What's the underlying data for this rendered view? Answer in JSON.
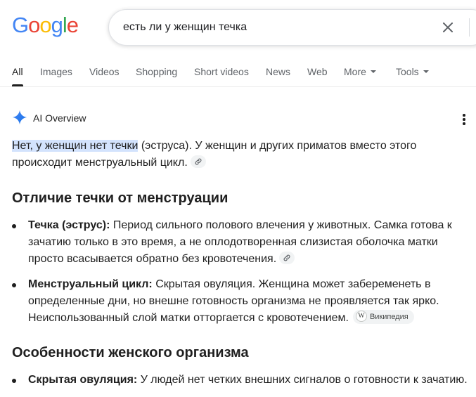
{
  "logo": {
    "letters": [
      "G",
      "o",
      "o",
      "g",
      "l",
      "e"
    ],
    "colors": [
      "#4285F4",
      "#EA4335",
      "#FBBC05",
      "#4285F4",
      "#34A853",
      "#EA4335"
    ]
  },
  "search": {
    "query": "есть ли у женщин течка"
  },
  "tabs": [
    {
      "label": "All",
      "active": true
    },
    {
      "label": "Images"
    },
    {
      "label": "Videos"
    },
    {
      "label": "Shopping"
    },
    {
      "label": "Short videos"
    },
    {
      "label": "News"
    },
    {
      "label": "Web"
    },
    {
      "label": "More",
      "dropdown": true
    },
    {
      "label": "Tools",
      "dropdown": true
    }
  ],
  "ai_overview": {
    "title": "AI Overview",
    "intro_highlight": "Нет, у женщин нет течки",
    "intro_rest": " (эструса). У женщин и других приматов вместо этого происходит менструальный цикл.",
    "section1": {
      "heading": "Отличие течки от менструации",
      "bullets": [
        {
          "term": "Течка (эструс):",
          "text": " Период сильного полового влечения у животных. Самка готова к зачатию только в это время, а не оплодотворенная слизистая оболочка матки просто всасывается обратно без кровотечения."
        },
        {
          "term": "Менструальный цикл:",
          "text": " Скрытая овуляция. Женщина может забеременеть в определенные дни, но внешне готовность организма не проявляется так ярко. Неиспользованный слой матки отторгается с кровотечением.",
          "source": "Википедия"
        }
      ]
    },
    "section2": {
      "heading": "Особенности женского организма",
      "bullets": [
        {
          "term": "Скрытая овуляция:",
          "text": " У людей нет четких внешних сигналов о готовности к зачатию."
        }
      ]
    }
  }
}
